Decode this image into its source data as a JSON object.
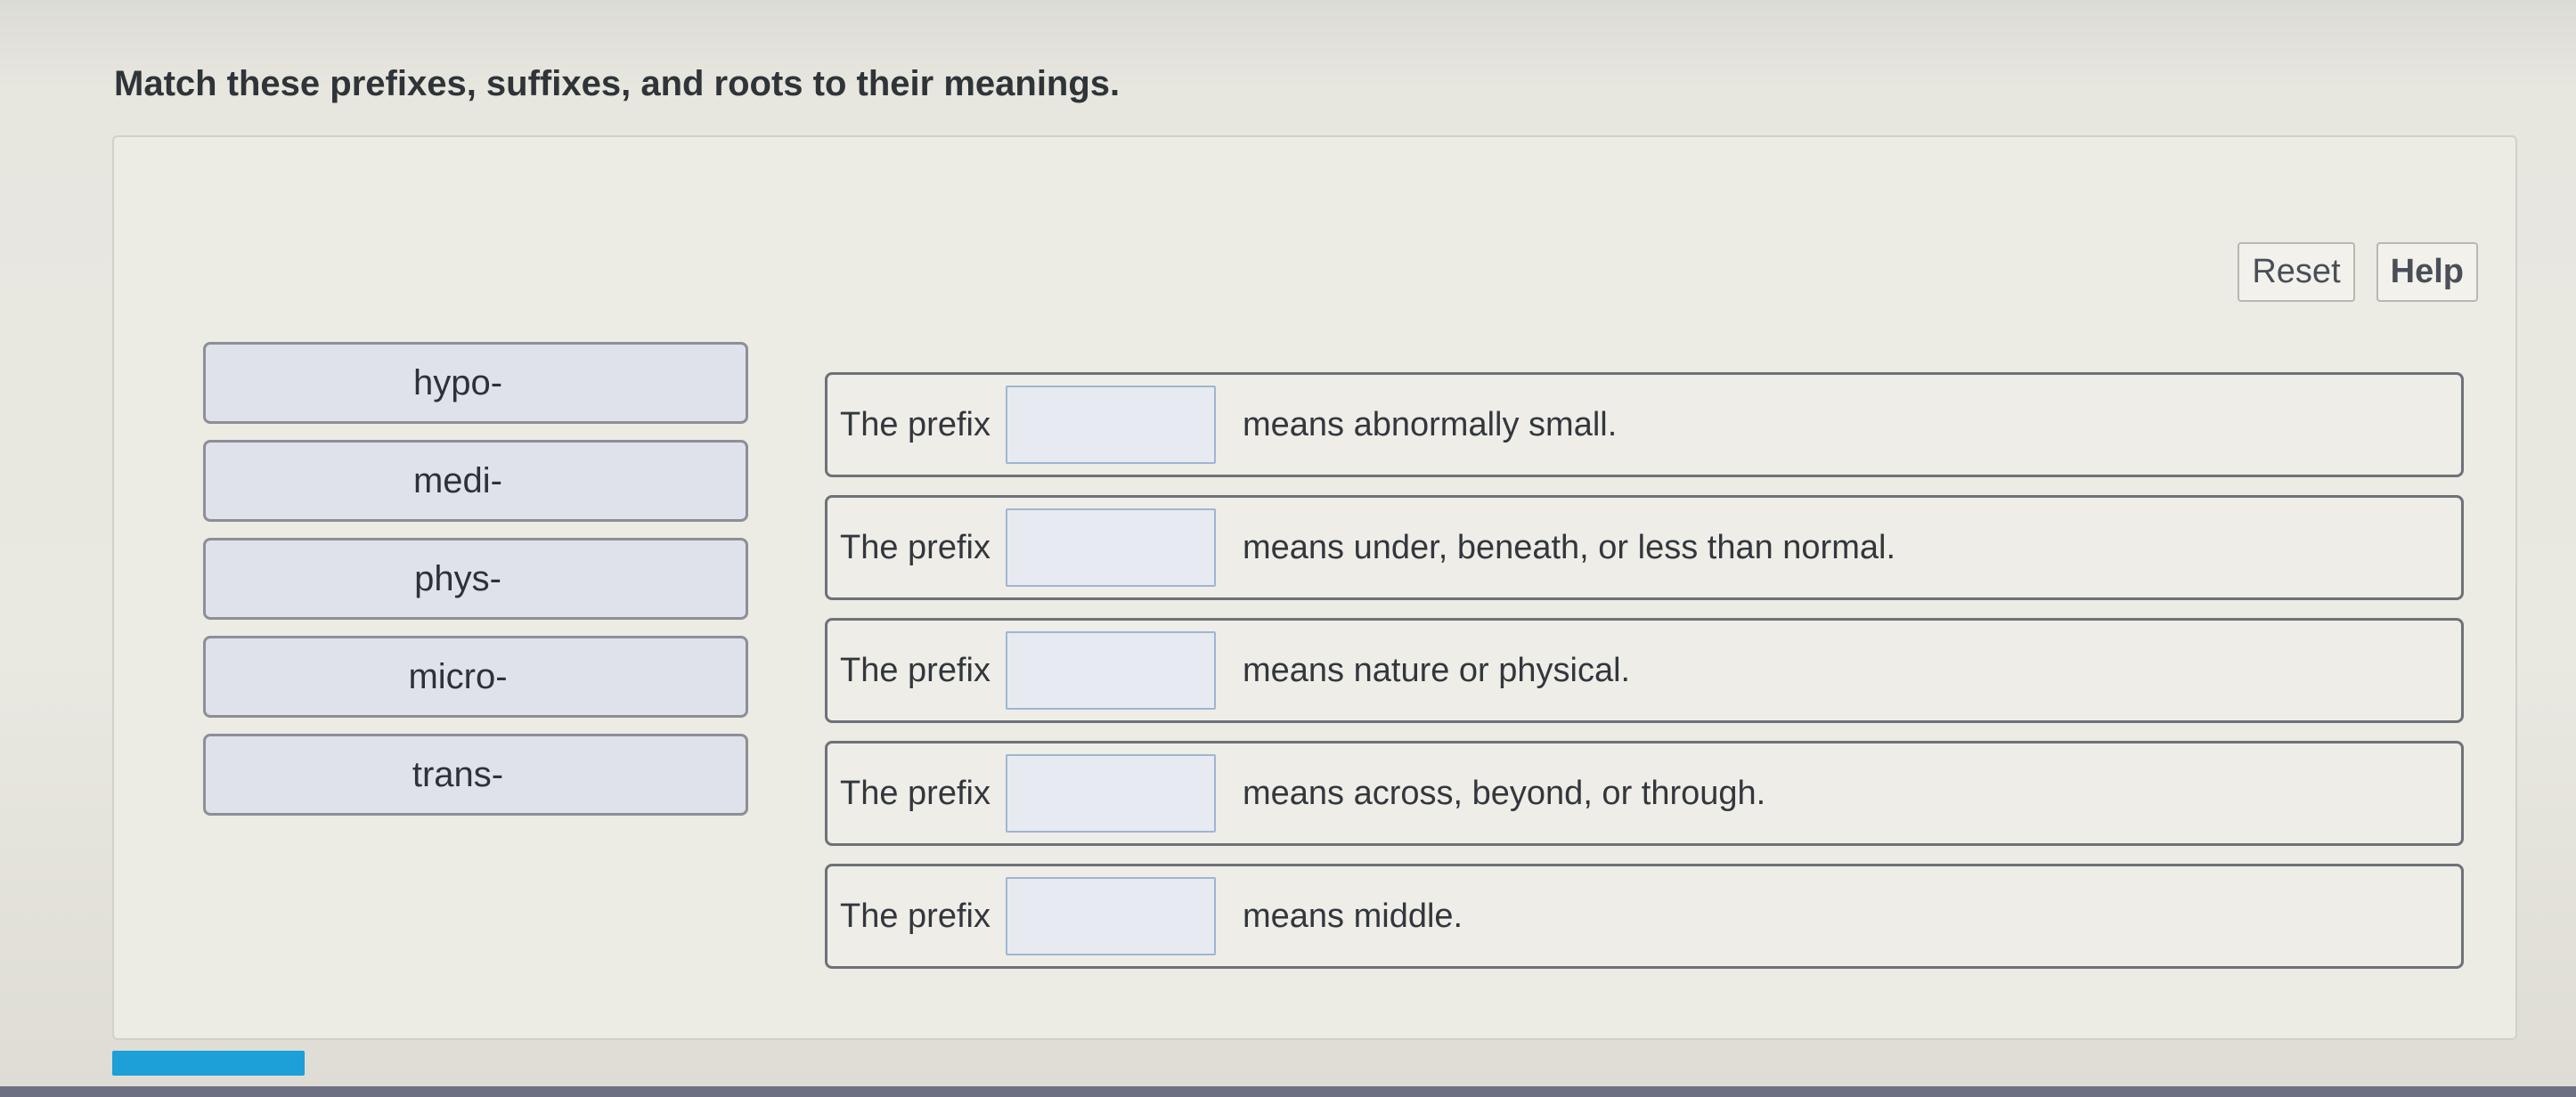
{
  "question": {
    "title": "Match these prefixes, suffixes, and roots to their meanings."
  },
  "toolbar": {
    "reset_label": "Reset",
    "help_label": "Help"
  },
  "chips": [
    {
      "label": "hypo-"
    },
    {
      "label": "medi-"
    },
    {
      "label": "phys-"
    },
    {
      "label": "micro-"
    },
    {
      "label": "trans-"
    }
  ],
  "rows": [
    {
      "prefix_label": "The prefix",
      "meaning": "means abnormally small."
    },
    {
      "prefix_label": "The prefix",
      "meaning": "means under, beneath, or less than normal."
    },
    {
      "prefix_label": "The prefix",
      "meaning": "means nature or physical."
    },
    {
      "prefix_label": "The prefix",
      "meaning": "means across, beyond, or through."
    },
    {
      "prefix_label": "The prefix",
      "meaning": "means middle."
    }
  ],
  "colors": {
    "accent": "#1d9fd8",
    "chip_bg": "#dfe2ea",
    "drop_target_border": "#9fb6d2"
  }
}
